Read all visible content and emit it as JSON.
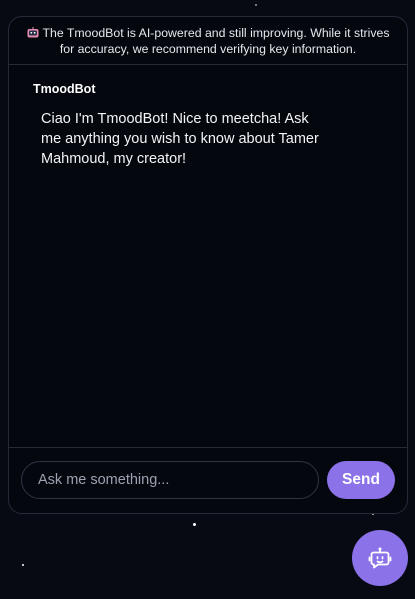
{
  "disclaimer": {
    "icon": "robot-emoji",
    "text": "The TmoodBot is AI-powered and still improving. While it strives for accuracy, we recommend verifying key information."
  },
  "messages": [
    {
      "sender": "TmoodBot",
      "text": "Ciao I'm TmoodBot! Nice to meetcha! Ask me anything you wish to know about Tamer Mahmoud, my creator!"
    }
  ],
  "composer": {
    "placeholder": "Ask me something...",
    "value": "",
    "send_label": "Send"
  },
  "launcher": {
    "icon": "chatbot-icon"
  },
  "colors": {
    "accent": "#8b72e8",
    "background": "#070a12",
    "panel": "#05070f",
    "border": "#262b38"
  }
}
